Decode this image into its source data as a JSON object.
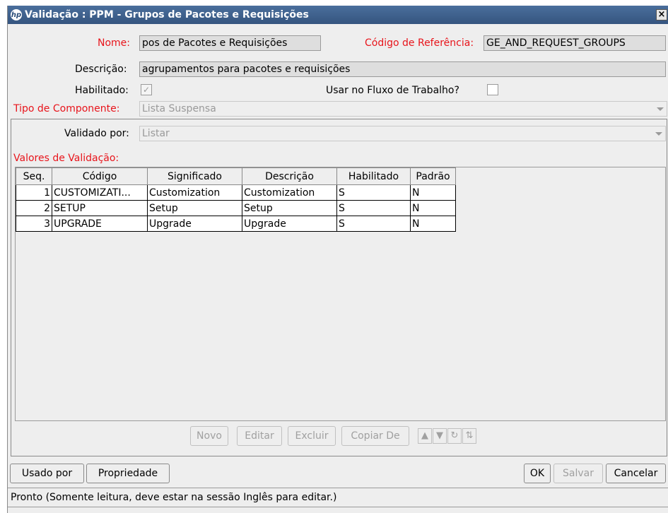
{
  "window": {
    "logo": "hp",
    "title": "Validação : PPM - Grupos de Pacotes e Requisições",
    "close": "×"
  },
  "form": {
    "nome_label": "Nome:",
    "nome_value": "pos de Pacotes e Requisições",
    "codigo_label": "Código de Referência:",
    "codigo_value": "GE_AND_REQUEST_GROUPS",
    "descricao_label": "Descrição:",
    "descricao_value": "agrupamentos para pacotes e requisições",
    "habilitado_label": "Habilitado:",
    "habilitado_checked": true,
    "fluxo_label": "Usar no Fluxo de Trabalho?",
    "fluxo_checked": false,
    "tipo_label": "Tipo de Componente:",
    "tipo_value": "Lista Suspensa",
    "validado_label": "Validado por:",
    "validado_value": "Listar"
  },
  "validation": {
    "section_label": "Valores de Validação:",
    "columns": [
      "Seq.",
      "Código",
      "Significado",
      "Descrição",
      "Habilitado",
      "Padrão"
    ],
    "rows": [
      [
        "1",
        "CUSTOMIZATI...",
        "Customization",
        "Customization",
        "S",
        "N"
      ],
      [
        "2",
        "SETUP",
        "Setup",
        "Setup",
        "S",
        "N"
      ],
      [
        "3",
        "UPGRADE",
        "Upgrade",
        "Upgrade",
        "S",
        "N"
      ]
    ],
    "buttons": {
      "novo": "Novo",
      "editar": "Editar",
      "excluir": "Excluir",
      "copiar": "Copiar De"
    }
  },
  "footer": {
    "usado_por": "Usado por",
    "propriedade": "Propriedade",
    "ok": "OK",
    "salvar": "Salvar",
    "cancelar": "Cancelar"
  },
  "status": "Pronto (Somente leitura, deve estar na sessão Inglês para editar.)",
  "colors": {
    "title_bar": "#3d5f8b",
    "required_label": "#e8141b",
    "disabled_text": "#9a9a9a"
  }
}
